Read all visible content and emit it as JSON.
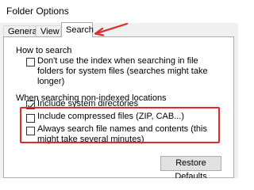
{
  "window": {
    "title": "Folder Options"
  },
  "tabs": [
    {
      "label": "General",
      "active": false
    },
    {
      "label": "View",
      "active": false
    },
    {
      "label": "Search",
      "active": true
    }
  ],
  "how_to_search": {
    "label": "How to search",
    "options": [
      {
        "label": "Don't use the index when searching in file folders for system files (searches might take longer)",
        "checked": false
      }
    ]
  },
  "non_indexed": {
    "label": "When searching non-indexed locations",
    "options": [
      {
        "label": "Include system directories",
        "checked": true
      },
      {
        "label": "Include compressed files (ZIP, CAB...)",
        "checked": false
      },
      {
        "label": "Always search file names and contents (this might take several minutes)",
        "checked": false
      }
    ]
  },
  "buttons": {
    "restore_defaults": "Restore Defaults"
  },
  "annotations": {
    "highlight_color": "#e02a2a",
    "arrow_color": "#e02a2a"
  }
}
